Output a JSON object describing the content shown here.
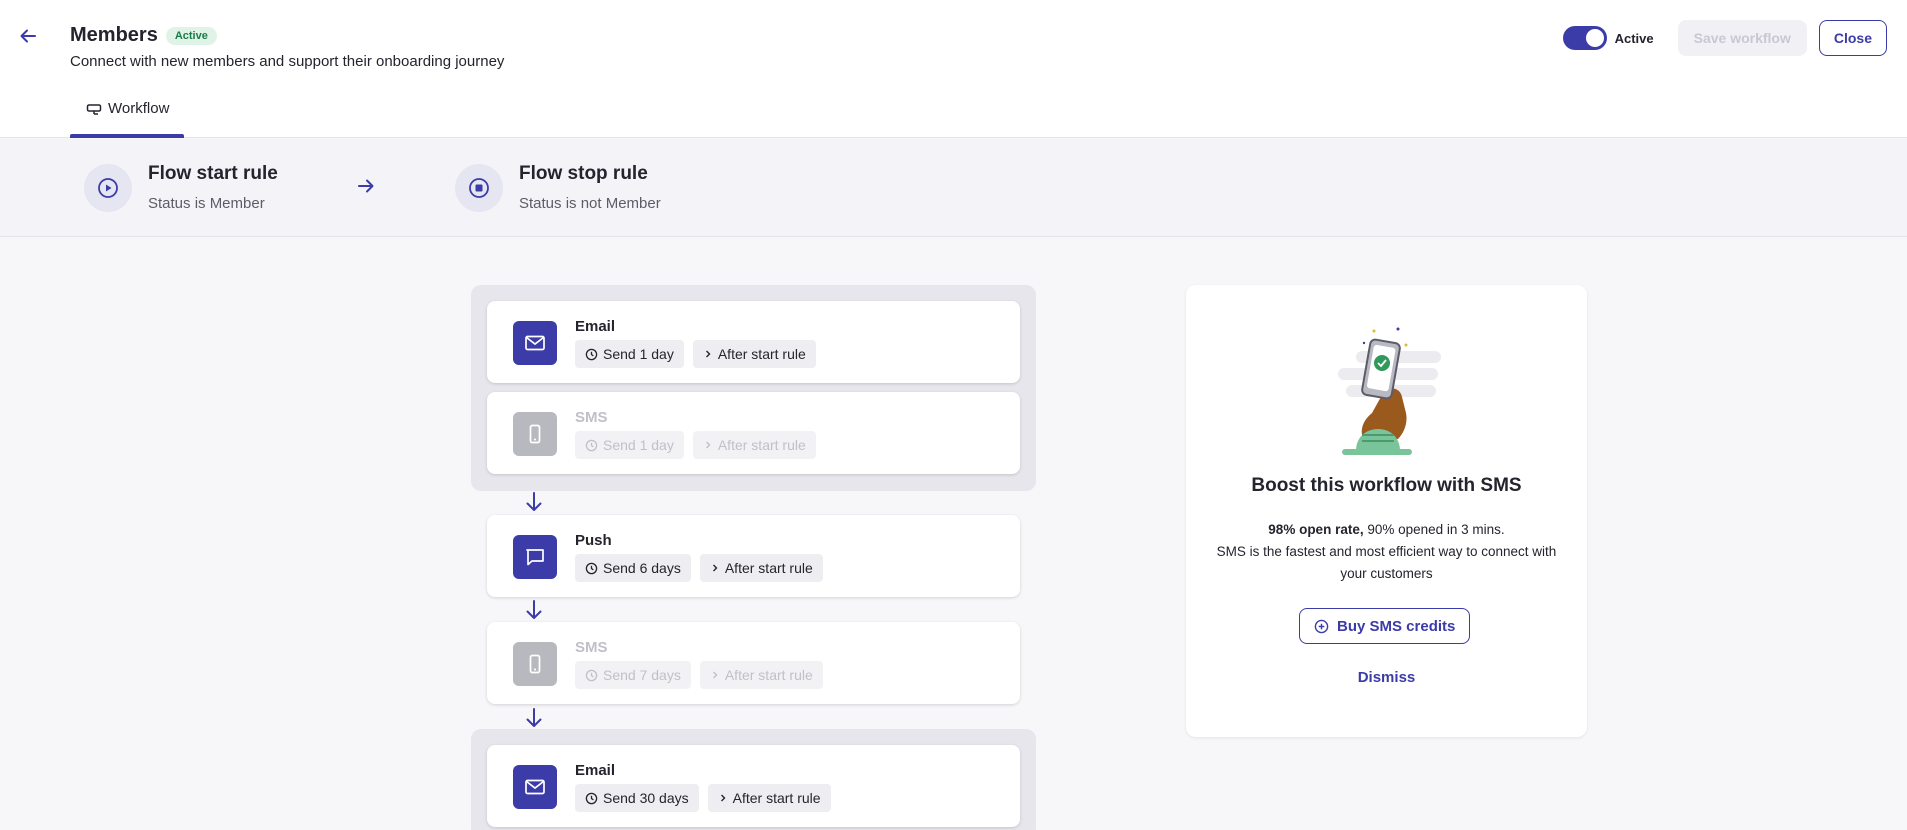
{
  "header": {
    "title": "Members",
    "status_badge": "Active",
    "subtitle": "Connect with new members and support their onboarding journey",
    "toggle_label": "Active",
    "save_label": "Save workflow",
    "close_label": "Close"
  },
  "tabs": [
    {
      "label": "Workflow",
      "icon": "workflow-icon"
    }
  ],
  "rules": {
    "start": {
      "title": "Flow start rule",
      "subtitle": "Status is Member",
      "icon": "play-icon"
    },
    "stop": {
      "title": "Flow stop rule",
      "subtitle": "Status is not Member",
      "icon": "stop-icon"
    }
  },
  "flow": [
    {
      "channel": "Email",
      "delay": "Send 1 day",
      "trigger": "After start rule",
      "enabled": true,
      "icon": "mail-icon"
    },
    {
      "channel": "SMS",
      "delay": "Send 1 day",
      "trigger": "After start rule",
      "enabled": false,
      "icon": "phone-icon"
    },
    {
      "channel": "Push",
      "delay": "Send 6 days",
      "trigger": "After start rule",
      "enabled": true,
      "icon": "chat-icon"
    },
    {
      "channel": "SMS",
      "delay": "Send 7 days",
      "trigger": "After start rule",
      "enabled": false,
      "icon": "phone-icon"
    },
    {
      "channel": "Email",
      "delay": "Send 30 days",
      "trigger": "After start rule",
      "enabled": true,
      "icon": "mail-icon"
    }
  ],
  "promo": {
    "title": "Boost this workflow with SMS",
    "text_bold": "98% open rate,",
    "text_rest": " 90% opened in 3 mins.",
    "text_line2": "SMS is the fastest and most efficient way to connect with your customers",
    "buy_label": "Buy SMS credits",
    "dismiss_label": "Dismiss"
  },
  "colors": {
    "accent": "#3c3ca8",
    "badge_bg": "#dff4e6",
    "badge_text": "#1d7a4b",
    "disabled_icon": "#b8b8bf"
  }
}
